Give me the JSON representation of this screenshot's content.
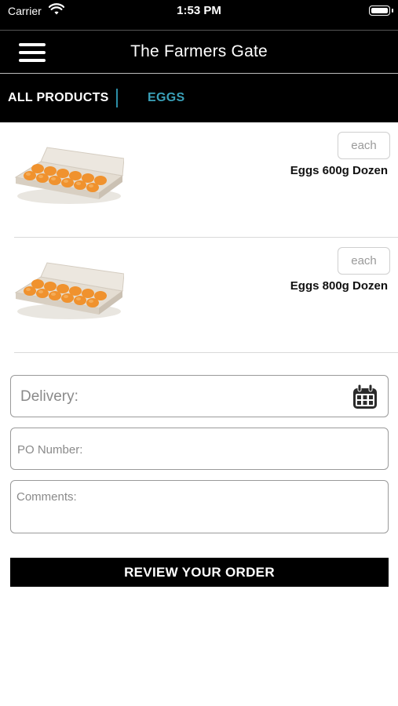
{
  "status_bar": {
    "carrier": "Carrier",
    "time": "1:53 PM"
  },
  "header": {
    "title": "The Farmers Gate",
    "menu_icon": "hamburger-menu-icon"
  },
  "categories": {
    "all_products": "ALL PRODUCTS",
    "active": "EGGS",
    "active_color": "#3aa0b8"
  },
  "products": [
    {
      "name": "Eggs 600g Dozen",
      "unit": "each",
      "image": "egg-carton-image"
    },
    {
      "name": "Eggs 800g Dozen",
      "unit": "each",
      "image": "egg-carton-image"
    }
  ],
  "form": {
    "delivery_placeholder": "Delivery:",
    "po_placeholder": "PO Number:",
    "comments_placeholder": "Comments:",
    "calendar_icon": "calendar-icon"
  },
  "actions": {
    "review_label": "REVIEW YOUR ORDER"
  }
}
